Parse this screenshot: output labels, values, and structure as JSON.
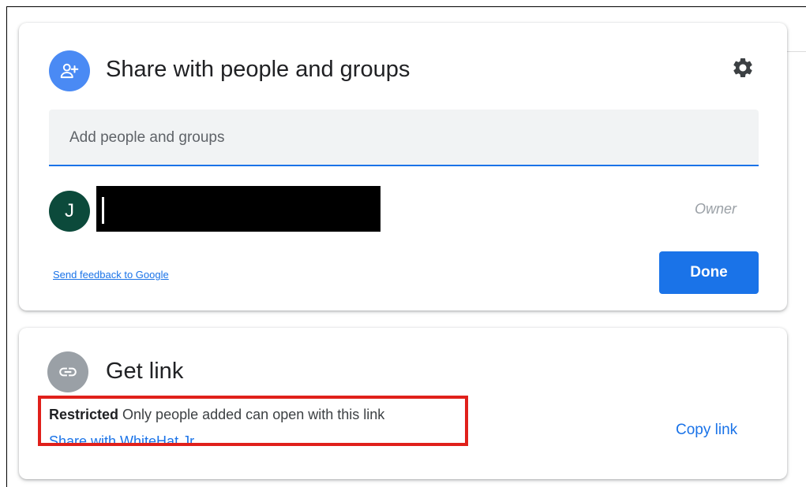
{
  "share_panel": {
    "title": "Share with people and groups",
    "add_input": {
      "value": "",
      "placeholder": "Add people and groups"
    },
    "person": {
      "avatar_initial": "J",
      "role": "Owner"
    },
    "feedback_link": "Send feedback to Google",
    "done_label": "Done"
  },
  "link_panel": {
    "title": "Get link",
    "access_level": "Restricted",
    "access_description": "Only people added can open with this link",
    "share_with_link": "Share with WhiteHat Jr",
    "copy_link_label": "Copy link"
  },
  "colors": {
    "accent": "#1a73e8",
    "avatar_bg": "#0c4a3b",
    "link_icon_bg": "#9aa0a6",
    "highlight": "#e0201b"
  },
  "icons": {
    "share_icon": "person-add-icon",
    "settings_icon": "gear-icon",
    "link_icon": "link-icon"
  }
}
